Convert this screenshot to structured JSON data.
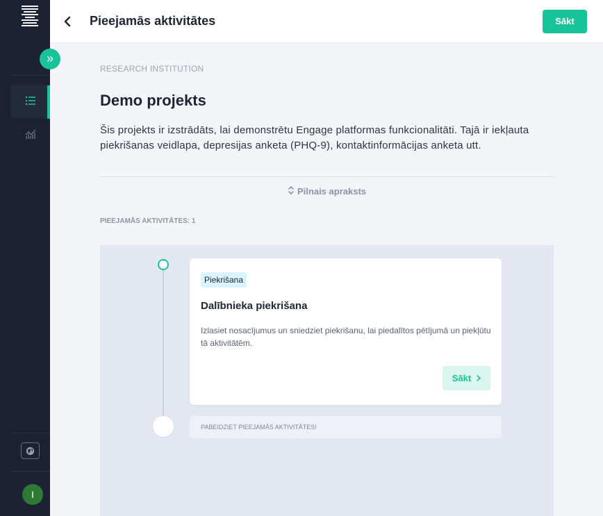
{
  "sidebar": {
    "logo": "menu-logo-icon",
    "expand_icon": "double-chevron-right-icon",
    "expand_label": "»",
    "nav_items": [
      {
        "name": "activities",
        "icon": "list-icon",
        "active": true
      },
      {
        "name": "insights",
        "icon": "chart-icon",
        "active": false
      }
    ],
    "language_icon": "globe-icon",
    "avatar_initial": "I"
  },
  "topbar": {
    "back_icon": "chevron-left-icon",
    "title": "Pieejamās aktivitātes",
    "start_label": "Sākt"
  },
  "project": {
    "organization": "RESEARCH INSTITUTION",
    "title": "Demo projekts",
    "description": "Šis projekts ir izstrādāts, lai demonstrētu Engage platformas funkcionalitāti. Tajā ir iekļauta piekrišanas veidlapa, depresijas anketa (PHQ-9), kontaktinformācijas anketa utt.",
    "full_description_label": "Pilnais apraksts",
    "full_description_icon": "expand-vertical-icon"
  },
  "activities": {
    "count_label": "PIEEJAMĀS AKTIVITĀTES: 1",
    "items": [
      {
        "badge": "Piekrišana",
        "title": "Dalībnieka piekrišana",
        "description": "Izlasiet nosacījumus un sniedziet piekrišanu, lai piedalītos pētījumā un piekļūtu tā aktivitātēm.",
        "start_label": "Sākt",
        "start_icon": "chevron-right-icon"
      }
    ],
    "end_label": "PABEIDZIET PIEEJAMĀS AKTIVITĀTES!"
  },
  "colors": {
    "accent": "#19c39a",
    "sidebar": "#1c2233",
    "background": "#f3f5f9",
    "badge": "#d8f4ff"
  }
}
